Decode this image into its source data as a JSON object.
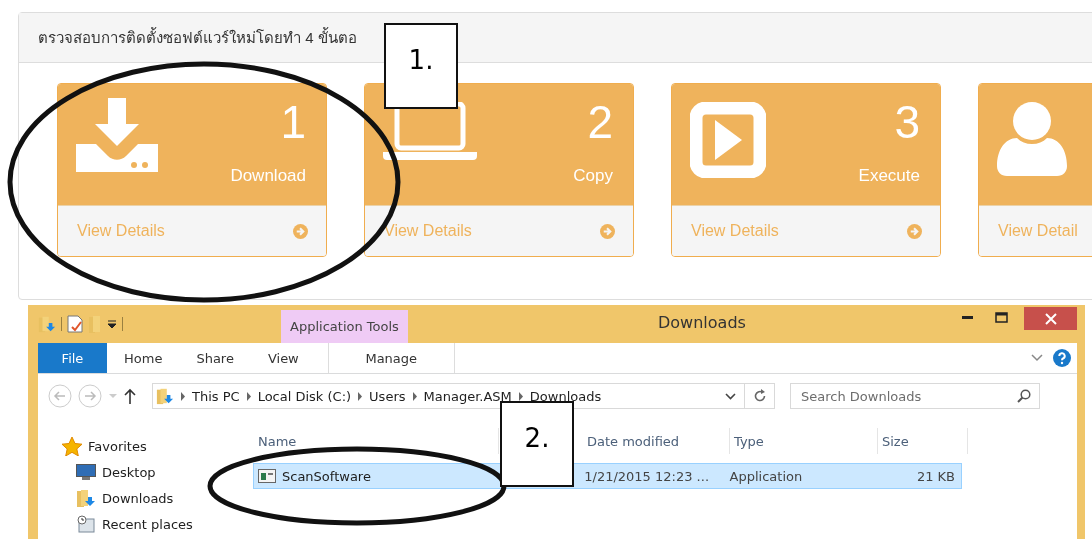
{
  "panel": {
    "title": "ตรวจสอบการติดตั้งซอฟต์แวร์ใหม่โดยทำ 4 ขั้นตอ",
    "cards": [
      {
        "kind": "download",
        "number": "1",
        "label": "Download",
        "link": "View Details"
      },
      {
        "kind": "laptop",
        "number": "2",
        "label": "Copy",
        "link": "View Details"
      },
      {
        "kind": "play",
        "number": "3",
        "label": "Execute",
        "link": "View Details"
      },
      {
        "kind": "user",
        "link": "View Detail"
      }
    ]
  },
  "explorer": {
    "title": "Downloads",
    "contextual_tab": "Application Tools",
    "ribbon_tabs": [
      {
        "label": "File",
        "kind": "file"
      },
      {
        "label": "Home",
        "kind": "tab"
      },
      {
        "label": "Share",
        "kind": "tab"
      },
      {
        "label": "View",
        "kind": "tab"
      },
      {
        "label": "Manage",
        "kind": "contextual"
      }
    ],
    "breadcrumb": [
      "This PC",
      "Local Disk (C:)",
      "Users",
      "Manager.ASM",
      "Downloads"
    ],
    "search": {
      "placeholder": "Search Downloads"
    },
    "nav": [
      {
        "label": "Favorites",
        "kind": "favorites"
      },
      {
        "label": "Desktop",
        "kind": "desktop"
      },
      {
        "label": "Downloads",
        "kind": "downloads"
      },
      {
        "label": "Recent places",
        "kind": "recent"
      }
    ],
    "columns": [
      "Name",
      "Date modified",
      "Type",
      "Size"
    ],
    "rows": [
      {
        "name": "ScanSoftware",
        "date": "1/21/2015 12:23 ...",
        "type": "Application",
        "size": "21 KB",
        "selected": true
      }
    ]
  },
  "annotations": [
    {
      "label": "1."
    },
    {
      "label": "2."
    }
  ]
}
